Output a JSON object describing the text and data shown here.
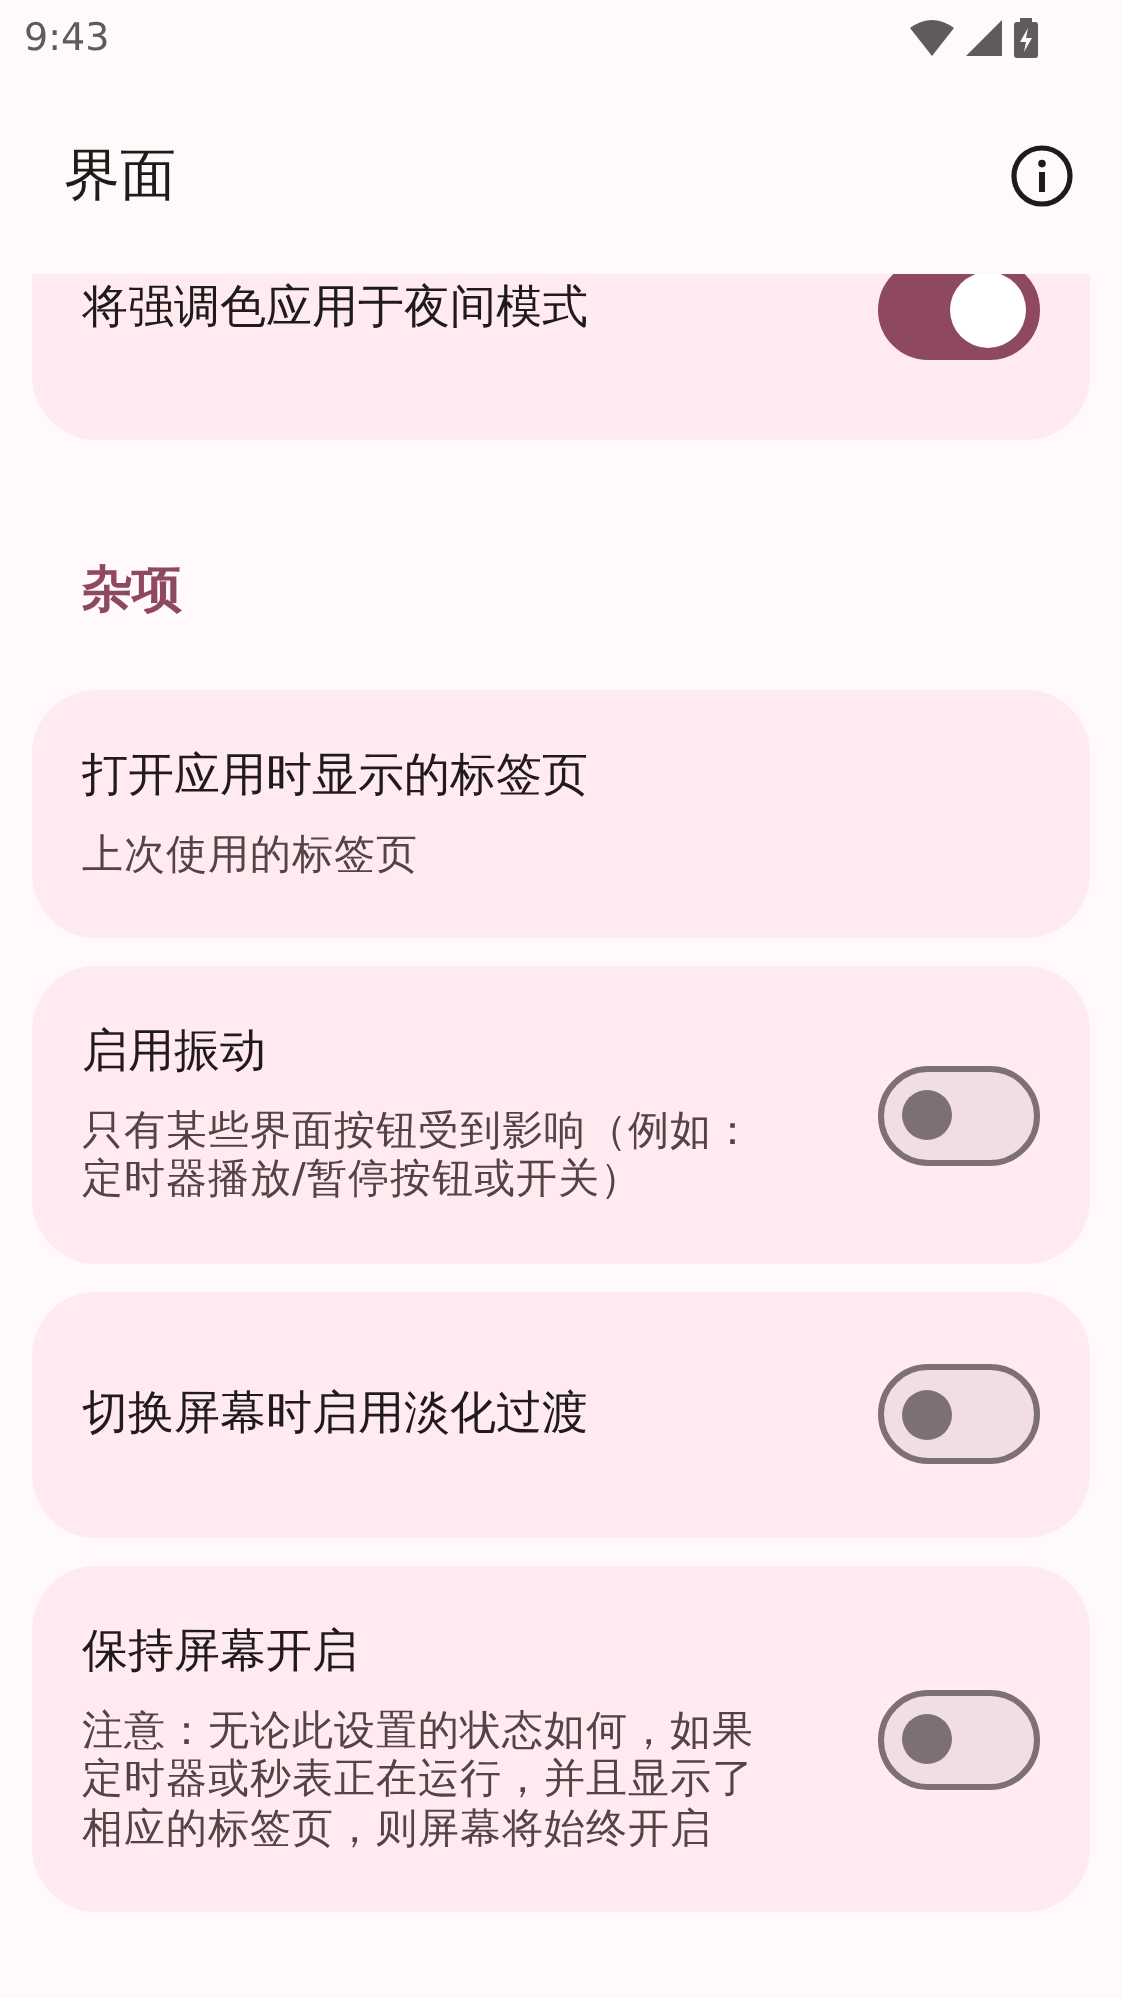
{
  "status_bar": {
    "time": "9:43"
  },
  "app_bar": {
    "title": "界面"
  },
  "items": [
    {
      "kind": "toggle",
      "cut": true,
      "title": "将强调色应用于夜间模式",
      "on": true
    },
    {
      "kind": "section",
      "title": "杂项"
    },
    {
      "kind": "value",
      "title": "打开应用时显示的标签页",
      "summary": "上次使用的标签页"
    },
    {
      "kind": "toggle",
      "title": "启用振动",
      "summary": "只有某些界面按钮受到影响（例如：定时器播放/暂停按钮或开关）",
      "on": false
    },
    {
      "kind": "toggle",
      "title": "切换屏幕时启用淡化过渡",
      "on": false
    },
    {
      "kind": "toggle",
      "title": "保持屏幕开启",
      "summary": "注意：无论此设置的状态如何，如果定时器或秒表正在运行，并且显示了相应的标签页，则屏幕将始终开启",
      "on": false
    }
  ]
}
